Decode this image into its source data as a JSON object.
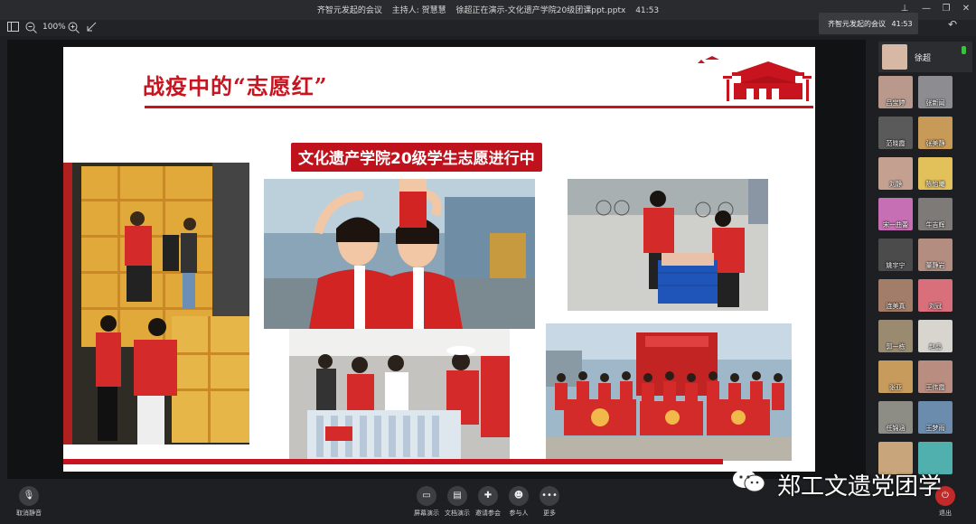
{
  "window": {
    "title_meeting": "齐智元发起的会议",
    "title_host": "主持人: 贺慧慧",
    "title_presenting": "徐超正在演示-文化遗产学院20级团课ppt.pptx",
    "title_time": "41:53"
  },
  "toolbar": {
    "zoom_value": "100%"
  },
  "meeting_popup": {
    "meeting_name": "齐智元发起的会议",
    "time": "41:53"
  },
  "slide": {
    "title": "战疫中的“志愿红”",
    "banner": "文化遗产学院20级学生志愿进行中"
  },
  "self": {
    "name": "徐超"
  },
  "participants": [
    {
      "name": "吕宝婷",
      "color": "#b9998c"
    },
    {
      "name": "张新闻",
      "color": "#8d8c90"
    },
    {
      "name": "范晓霞",
      "color": "#5a5a5a"
    },
    {
      "name": "张美静",
      "color": "#c89a57"
    },
    {
      "name": "刘静",
      "color": "#c4a091"
    },
    {
      "name": "陈怡曦",
      "color": "#e3c15a"
    },
    {
      "name": "宋一曲蕾",
      "color": "#c66fb4"
    },
    {
      "name": "牛吉辉",
      "color": "#7d7a77"
    },
    {
      "name": "姚宇宁",
      "color": "#4b4b4b"
    },
    {
      "name": "董静岩",
      "color": "#b38d7f"
    },
    {
      "name": "连美真",
      "color": "#a27d68"
    },
    {
      "name": "刘冠",
      "color": "#d86f7b"
    },
    {
      "name": "郭一栋",
      "color": "#9a8a70"
    },
    {
      "name": "赵晶",
      "color": "#d8d5cf"
    },
    {
      "name": "张亚",
      "color": "#c79b5b"
    },
    {
      "name": "王伟霞",
      "color": "#b98d80"
    },
    {
      "name": "任锦涵",
      "color": "#8d8d86"
    },
    {
      "name": "王梦雨",
      "color": "#6c8cad"
    },
    {
      "name": "",
      "color": "#c8a57b"
    },
    {
      "name": "",
      "color": "#4fb0ad"
    }
  ],
  "bottom": {
    "mute_label": "取消静音",
    "share_label": "屏幕演示",
    "doc_label": "文档演示",
    "invite_label": "邀请参会",
    "members_label": "参与人",
    "more_label": "更多",
    "exit_label": "退出"
  },
  "watermark": {
    "text": "郑工文遗党团学"
  },
  "icons": {
    "layout": "sidebar-layout-icon",
    "zoom_out": "zoom-out-icon",
    "zoom_in": "zoom-in-icon",
    "fullscreen": "collapse-arrow-icon"
  },
  "colors": {
    "accent_red": "#c8141f",
    "exit_red": "#c22a2a",
    "mic_green": "#3fbf3f"
  }
}
